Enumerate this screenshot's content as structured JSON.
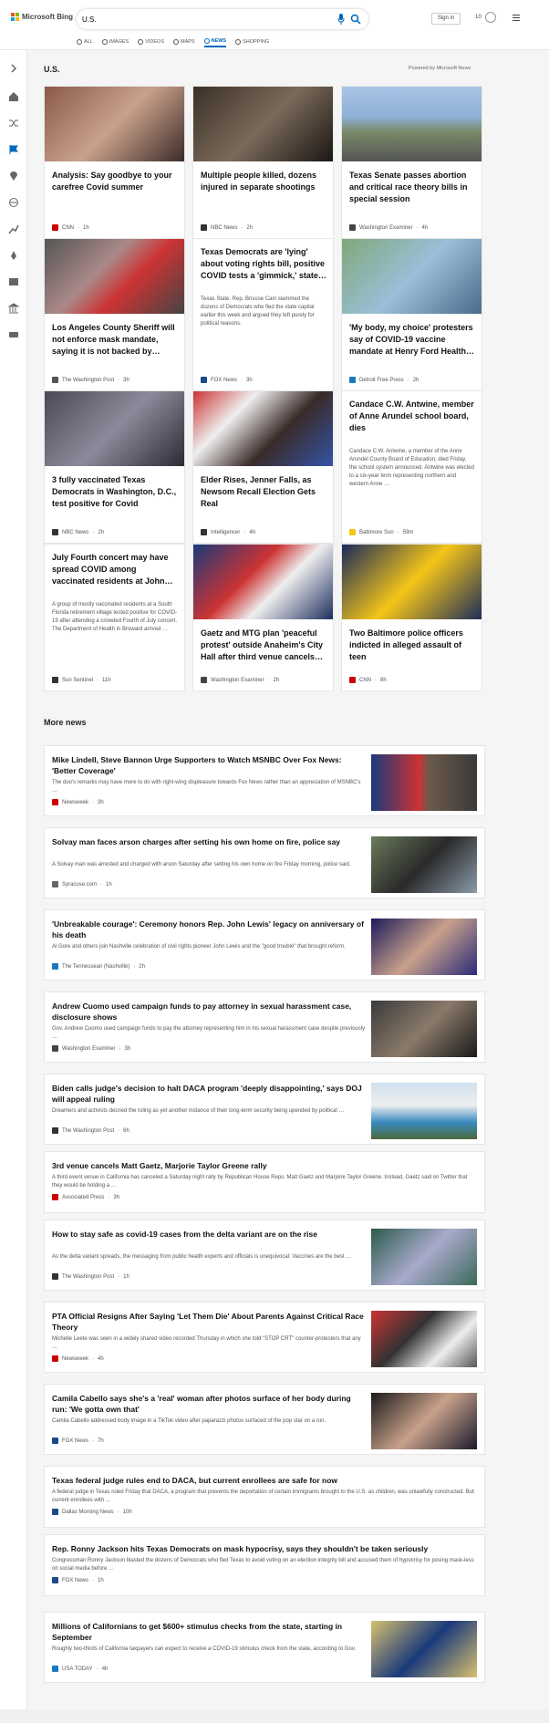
{
  "header": {
    "brand": "Microsoft Bing",
    "search_value": "U.S.",
    "signin_label": "Sign in",
    "rewards_count": "10"
  },
  "tabs": [
    {
      "label": "ALL"
    },
    {
      "label": "IMAGES"
    },
    {
      "label": "VIDEOS"
    },
    {
      "label": "MAPS"
    },
    {
      "label": "NEWS",
      "active": true
    },
    {
      "label": "SHOPPING"
    }
  ],
  "section": {
    "title": "U.S.",
    "powered_by": "Powered by Microsoft News"
  },
  "cards": [
    {
      "title": "Analysis: Say goodbye to your carefree Covid summer",
      "source": "CNN",
      "time": "1h"
    },
    {
      "title": "Multiple people killed, dozens injured in separate shootings",
      "source": "NBC News",
      "time": "2h"
    },
    {
      "title": "Texas Senate passes abortion and critical race theory bills in special session",
      "source": "Washington Examiner",
      "time": "4h"
    },
    {
      "title": "Los Angeles County Sheriff will not enforce mask mandate, saying it is not backed by…",
      "source": "The Washington Post",
      "time": "3h"
    },
    {
      "title": "Texas Democrats are 'lying' about voting rights bill, positive COVID tests a 'gimmick,' state…",
      "snippet": "Texas State. Rep. Briscoe Cain slammed the dozens of Democrats who fled the state capital earlier this week and argued they left purely for political reasons.",
      "source": "FOX News",
      "time": "3h"
    },
    {
      "title": "'My body, my choice' protesters say of COVID-19 vaccine mandate at Henry Ford Health…",
      "source": "Detroit Free Press",
      "time": "2h"
    },
    {
      "title": "3 fully vaccinated Texas Democrats in Washington, D.C., test positive for Covid",
      "source": "NBC News",
      "time": "2h"
    },
    {
      "title": "Elder Rises, Jenner Falls, as Newsom Recall Election Gets Real",
      "source": "Intelligencer",
      "time": "4h"
    },
    {
      "title": "Candace C.W. Antwine, member of Anne Arundel school board, dies",
      "snippet": "Candace C.W. Antwine, a member of the Anne Arundel County Board of Education, died Friday, the school system announced. Antwine was elected to a six-year term representing northern and western Anne …",
      "source": "Baltimore Sun",
      "time": "59m"
    },
    {
      "title": "July Fourth concert may have spread COVID among vaccinated residents at John…",
      "snippet": "A group of mostly vaccinated residents at a South Florida retirement village tested positive for COVID-19 after attending a crowded Fourth of July concert. The Department of Health in Broward arrived …",
      "source": "Sun Sentinel",
      "time": "11h"
    },
    {
      "title": "Gaetz and MTG plan 'peaceful protest' outside Anaheim's City Hall after third venue cancels…",
      "source": "Washington Examiner",
      "time": "2h"
    },
    {
      "title": "Two Baltimore police officers indicted in alleged assault of teen",
      "source": "CNN",
      "time": "8h"
    }
  ],
  "more_news": {
    "title": "More news",
    "items": [
      {
        "title": "Mike Lindell, Steve Bannon Urge Supporters to Watch MSNBC Over Fox News: 'Better Coverage'",
        "snippet": "The duo's remarks may have more to do with right-wing displeasure towards Fox News rather than an appreciation of MSNBC's …",
        "source": "Newsweek",
        "time": "3h"
      },
      {
        "title": "Solvay man faces arson charges after setting his own home on fire, police say",
        "snippet": "A Solvay man was arrested and charged with arson Saturday after setting his own home on fire Friday morning, police said.",
        "source": "Syracuse.com",
        "time": "1h"
      },
      {
        "title": "'Unbreakable courage': Ceremony honors Rep. John Lewis' legacy on anniversary of his death",
        "snippet": "Al Gore and others join Nashville celebration of civil rights pioneer John Lewis and the \"good trouble\" that brought reform.",
        "source": "The Tennessean (Nashville)",
        "time": "2h"
      },
      {
        "title": "Andrew Cuomo used campaign funds to pay attorney in sexual harassment case, disclosure shows",
        "snippet": "Gov. Andrew Cuomo used campaign funds to pay the attorney representing him in his sexual harassment case despite previously …",
        "source": "Washington Examiner",
        "time": "3h"
      },
      {
        "title": "Biden calls judge's decision to halt DACA program 'deeply disappointing,' says DOJ will appeal ruling",
        "snippet": "Dreamers and activists decried the ruling as yet another instance of their long-term security being upended by political …",
        "source": "The Washington Post",
        "time": "6h"
      },
      {
        "title": "3rd venue cancels Matt Gaetz, Marjorie Taylor Greene rally",
        "snippet": "A third event venue in California has canceled a Saturday night rally by Republican House Reps. Matt Gaetz and Marjorie Taylor Greene. Instead, Gaetz said on Twitter that they would be holding a …",
        "source": "Associated Press",
        "time": "3h"
      },
      {
        "title": "How to stay safe as covid-19 cases from the delta variant are on the rise",
        "snippet": "As the delta variant spreads, the messaging from public health experts and officials is unequivocal: Vaccines are the best …",
        "source": "The Washington Post",
        "time": "1h"
      },
      {
        "title": "PTA Official Resigns After Saying 'Let Them Die' About Parents Against Critical Race Theory",
        "snippet": "Michelle Leete was seen in a widely shared video recorded Thursday in which she told \"STOP CRT\" counter-protesters that any …",
        "source": "Newsweek",
        "time": "4h"
      },
      {
        "title": "Camila Cabello says she's a 'real' woman after photos surface of her body during run: 'We gotta own that'",
        "snippet": "Camila Cabello addressed body image in a TikTok video after paparazzi photos surfaced of the pop star on a run.",
        "source": "FOX News",
        "time": "7h"
      },
      {
        "title": "Texas federal judge rules end to DACA, but current enrollees are safe for now",
        "snippet": "A federal judge in Texas ruled Friday that DACA, a program that prevents the deportation of certain immigrants brought to the U.S. as children, was unlawfully constructed. But current enrollees with …",
        "source": "Dallas Morning News",
        "time": "10h"
      },
      {
        "title": "Rep. Ronny Jackson hits Texas Democrats on mask hypocrisy, says they shouldn't be taken seriously",
        "snippet": "Congressman Ronny Jackson blasted the dozens of Democrats who fled Texas to avoid voting on an election integrity bill and accused them of hypocrisy for posing mask-less on social media before …",
        "source": "FOX News",
        "time": "1h"
      },
      {
        "title": "Millions of Californians to get $600+ stimulus checks from the state, starting in September",
        "snippet": "Roughly two-thirds of California taxpayers can expect to receive a COVID-19 stimulus check from the state, according to Gov.",
        "source": "USA TODAY",
        "time": "4h"
      }
    ]
  },
  "colors": {
    "accent": "#0067b8",
    "card_bg": "#ffffff",
    "page_bg": "#f5f5f5"
  }
}
